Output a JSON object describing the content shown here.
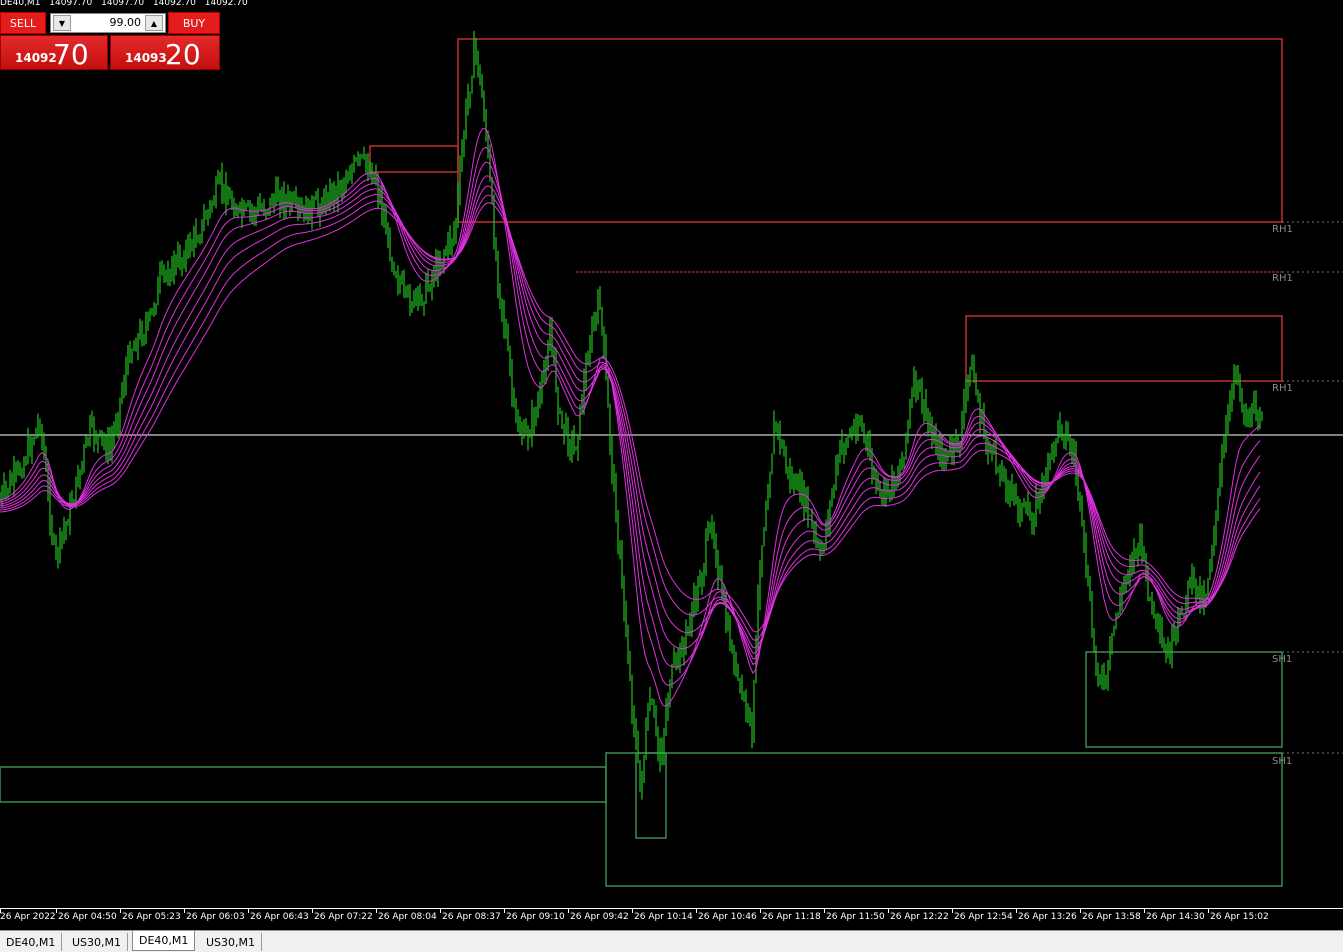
{
  "header": {
    "symbol": "DE40,M1",
    "ohlc": [
      "14097.70",
      "14097.70",
      "14092.70",
      "14092.70"
    ]
  },
  "trade_panel": {
    "sell_label": "SELL",
    "buy_label": "BUY",
    "lot": "99.00",
    "sell_small": "14092",
    "sell_big": "70",
    "buy_small": "14093",
    "buy_big": "20"
  },
  "levels": [
    "RH1",
    "RH1",
    "RH1",
    "SH1",
    "SH1"
  ],
  "time_axis": [
    "26 Apr 2022",
    "26 Apr 04:50",
    "26 Apr 05:23",
    "26 Apr 06:03",
    "26 Apr 06:43",
    "26 Apr 07:22",
    "26 Apr 08:04",
    "26 Apr 08:37",
    "26 Apr 09:10",
    "26 Apr 09:42",
    "26 Apr 10:14",
    "26 Apr 10:46",
    "26 Apr 11:18",
    "26 Apr 11:50",
    "26 Apr 12:22",
    "26 Apr 12:54",
    "26 Apr 13:26",
    "26 Apr 13:58",
    "26 Apr 14:30",
    "26 Apr 15:02"
  ],
  "tabs": [
    "DE40,M1",
    "US30,M1",
    "DE40,M1",
    "US30,M1"
  ],
  "active_tab": 2,
  "colors": {
    "candle": "#22c322",
    "ma": "#e030e0",
    "resistance_box": "#c0302e",
    "support_box": "#3c8a55",
    "current_price_line": "#ffffff"
  }
}
